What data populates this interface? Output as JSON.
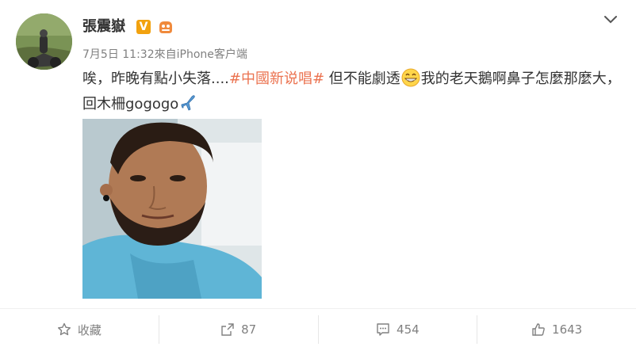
{
  "post": {
    "author": "張震嶽",
    "verified_badge": "V",
    "timestamp": "7月5日 11:32",
    "source": "來自iPhone客户端",
    "text_part1": "唉，昨晚有點小失落....",
    "topic": "#中國新说唱#",
    "text_part2": " 但不能劇透",
    "text_part3": "我的老天鵝啊鼻子怎麼那麼大，回木柵gogogo",
    "emoji_1": "grin-emoji",
    "emoji_2": "airplane-emoji"
  },
  "actions": {
    "favorite_label": "收藏",
    "repost_count": "87",
    "comment_count": "454",
    "like_count": "1643"
  },
  "colors": {
    "topic": "#eb7350",
    "meta": "#808080",
    "verified": "#f2a20f"
  }
}
